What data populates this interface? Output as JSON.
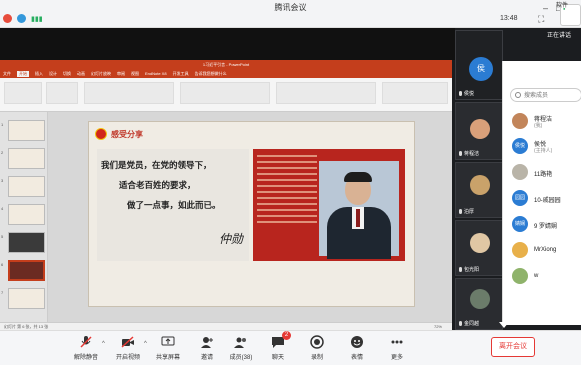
{
  "window": {
    "title": "腾讯会议",
    "time": "13:48",
    "side_label_top": "软件",
    "side_label_speaking": "正在讲话"
  },
  "ppt": {
    "title": "1习近平引言 - PowerPoint",
    "tabs": [
      "文件",
      "开始",
      "插入",
      "设计",
      "切换",
      "动画",
      "幻灯片放映",
      "审阅",
      "视图",
      "EndNote X8",
      "开发工具",
      "告诉我您想做什么"
    ],
    "active_tab": "开始",
    "slide_numbers": [
      "1",
      "2",
      "3",
      "4",
      "5",
      "6",
      "7"
    ],
    "status_left": "幻灯片 第 6 张，共 13 张",
    "zoom": "72%",
    "slide": {
      "title": "感受分享",
      "quote_lines": [
        "我们是党员，在党的领导下，",
        "适合老百姓的要求，",
        "做了一点事，如此而已。"
      ],
      "signature": "仲勋"
    }
  },
  "tiles": [
    {
      "label": "侯悦",
      "avatar": "侯"
    },
    {
      "label": "蒋程洁",
      "avatar": ""
    },
    {
      "label": "泊厚",
      "avatar": ""
    },
    {
      "label": "包光阳",
      "avatar": ""
    },
    {
      "label": "金同越",
      "avatar": ""
    }
  ],
  "members": {
    "search_placeholder": "搜索成员",
    "list": [
      {
        "name": "蒋程洁",
        "role": "(我)",
        "avatar": ""
      },
      {
        "name": "侯悦",
        "role": "(主持人)",
        "avatar": "侯悦"
      },
      {
        "name": "11路艳",
        "role": "",
        "avatar": ""
      },
      {
        "name": "10-戚园园",
        "role": "",
        "avatar": "园园"
      },
      {
        "name": "9 罗婧娴",
        "role": "",
        "avatar": "婧娴"
      },
      {
        "name": "MrXiong",
        "role": "",
        "avatar": ""
      },
      {
        "name": "w",
        "role": "",
        "avatar": ""
      }
    ]
  },
  "toolbar": {
    "mute": "解除静音",
    "video": "开启视频",
    "share": "共享屏幕",
    "invite": "邀请",
    "members": "成员(38)",
    "chat": "聊天",
    "chat_badge": "2",
    "record": "录制",
    "reaction": "表情",
    "more": "更多",
    "end": "离开会议"
  }
}
